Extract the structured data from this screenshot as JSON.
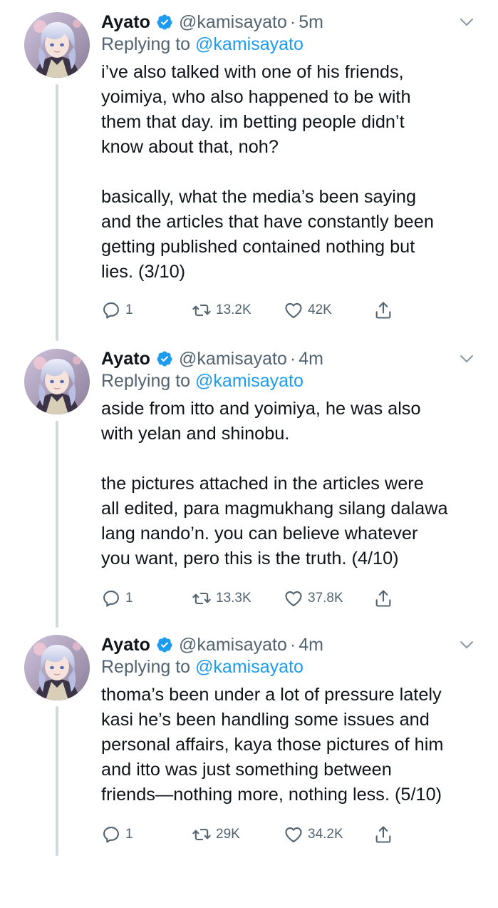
{
  "tweets": [
    {
      "name": "Ayato",
      "handle": "@kamisayato",
      "dot": "·",
      "time": "5m",
      "replying_prefix": "Replying to",
      "replying_to": "@kamisayato",
      "lines": [
        "i’ve also talked with one of his friends,",
        "yoimiya, who also happened to be with",
        "them that day. im betting people didn’t",
        "know about that, noh?",
        "",
        "basically, what the media’s been saying",
        "and the articles that have constantly been",
        "getting published contained nothing but",
        "lies. (3/10)"
      ],
      "replies": "1",
      "retweets": "13.2K",
      "likes": "42K"
    },
    {
      "name": "Ayato",
      "handle": "@kamisayato",
      "dot": "·",
      "time": "4m",
      "replying_prefix": "Replying to",
      "replying_to": "@kamisayato",
      "lines": [
        "aside from itto and yoimiya, he was also",
        "with yelan and shinobu.",
        "",
        "the pictures attached in the articles were",
        "all edited, para magmukhang silang dalawa",
        "lang nando’n. you can believe whatever",
        "you want, pero this is the truth. (4/10)"
      ],
      "replies": "1",
      "retweets": "13.3K",
      "likes": "37.8K"
    },
    {
      "name": "Ayato",
      "handle": "@kamisayato",
      "dot": "·",
      "time": "4m",
      "replying_prefix": "Replying to",
      "replying_to": "@kamisayato",
      "lines": [
        "thoma’s been under a lot of pressure lately",
        "kasi he’s been handling some issues and",
        "personal affairs, kaya those pictures of him",
        "and itto was just something between",
        "friends—nothing more, nothing less. (5/10)"
      ],
      "replies": "1",
      "retweets": "29K",
      "likes": "34.2K"
    }
  ],
  "icons": {
    "verified": "verified-badge-icon",
    "more": "chevron-down-icon",
    "reply": "reply-icon",
    "retweet": "retweet-icon",
    "like": "heart-icon",
    "share": "share-icon"
  },
  "colors": {
    "accent": "#1d9bf0",
    "muted": "#536471",
    "thread_line": "#cfd9de"
  }
}
